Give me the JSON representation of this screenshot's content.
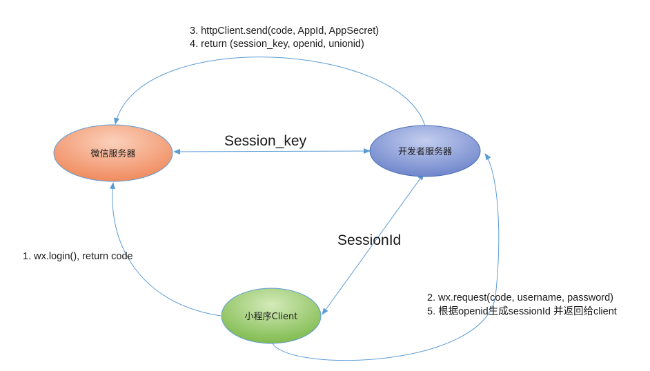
{
  "nodes": {
    "wechat_server": {
      "label": "微信服务器"
    },
    "dev_server": {
      "label": "开发者服务器"
    },
    "mini_client": {
      "label": "小程序Client"
    }
  },
  "edges": {
    "session_key_label": "Session_key",
    "session_id_label": "SessionId",
    "login": {
      "text": "1. wx.login(), return code"
    },
    "request": {
      "line1": "2. wx.request(code, username, password)",
      "line2": "5. 根据openid生成sessionId 并返回给client"
    },
    "http": {
      "line1": "3. httpClient.send(code, AppId, AppSecret)",
      "line2": "4. return (session_key, openid, unionid)"
    }
  },
  "colors": {
    "edge": "#5b9bd5",
    "wechat_fill": "#f4a582",
    "dev_fill": "#8fa5d9",
    "client_fill": "#9dcf71"
  }
}
